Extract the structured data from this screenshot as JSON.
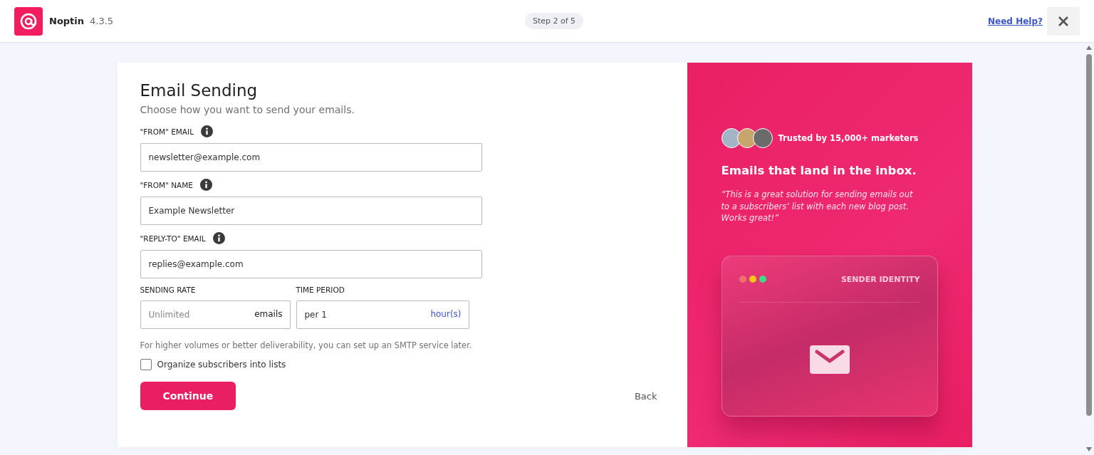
{
  "header": {
    "app_name": "Noptin",
    "version": "4.3.5",
    "step": "Step 2 of 5",
    "help_link": "Need Help?"
  },
  "form": {
    "title": "Email Sending",
    "subtitle": "Choose how you want to send your emails.",
    "fields": [
      {
        "label": "\"FROM\" EMAIL",
        "value": "newsletter@example.com"
      },
      {
        "label": "\"FROM\" NAME",
        "value": "Example Newsletter"
      },
      {
        "label": "\"REPLY-TO\" EMAIL",
        "value": "replies@example.com"
      }
    ],
    "sending_rate": {
      "label": "SENDING RATE",
      "placeholder": "Unlimited",
      "suffix": "emails"
    },
    "time_period": {
      "label": "TIME PERIOD",
      "value": "per 1",
      "unit": "hour(s)"
    },
    "note": "For higher volumes or better deliverability, you can set up an SMTP service later.",
    "organize_lists": {
      "label": "Organize subscribers into lists",
      "checked": false
    },
    "continue_button": "Continue",
    "back_link": "Back"
  },
  "promo": {
    "trust_text": "Trusted by 15,000+ marketers",
    "headline": "Emails that land in the inbox.",
    "quote": "“This is a great solution for sending emails out to a subscribers’ list with each new blog post. Works great!”",
    "card_title": "SENDER IDENTITY",
    "dots": [
      {
        "color": "#f07070"
      },
      {
        "color": "#f5c518"
      },
      {
        "color": "#3ddc84"
      }
    ]
  }
}
